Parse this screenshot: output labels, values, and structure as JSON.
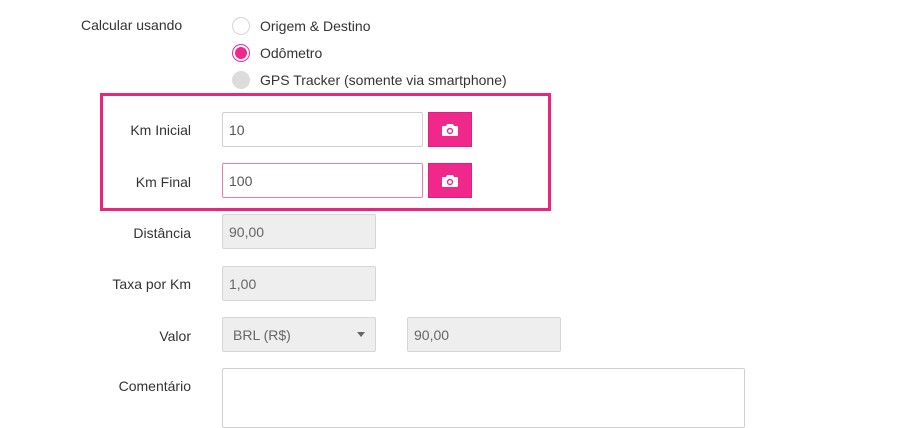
{
  "calc": {
    "label": "Calcular usando",
    "options": [
      {
        "label": "Origem & Destino",
        "state": "unchecked"
      },
      {
        "label": "Odômetro",
        "state": "checked"
      },
      {
        "label": "GPS Tracker (somente via smartphone)",
        "state": "disabled"
      }
    ]
  },
  "km_inicial": {
    "label": "Km Inicial",
    "value": "10",
    "camera_icon": "camera-icon"
  },
  "km_final": {
    "label": "Km Final",
    "value": "100",
    "camera_icon": "camera-icon"
  },
  "distancia": {
    "label": "Distância",
    "value": "90,00"
  },
  "taxa": {
    "label": "Taxa por Km",
    "value": "1,00"
  },
  "valor": {
    "label": "Valor",
    "currency": "BRL (R$)",
    "amount": "90,00"
  },
  "comentario": {
    "label": "Comentário",
    "value": ""
  },
  "colors": {
    "accent": "#f0288c",
    "highlight": "#e8267f",
    "readonly_bg": "#eeeeee"
  }
}
